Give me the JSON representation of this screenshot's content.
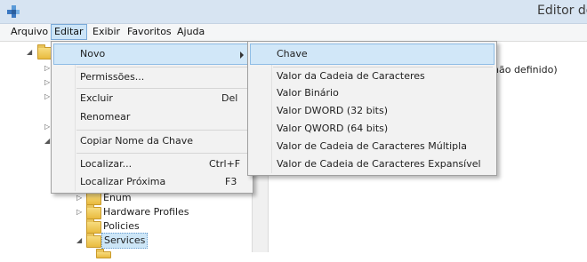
{
  "window": {
    "title": "Editor do Registro"
  },
  "menubar": {
    "items": [
      "Arquivo",
      "Editar",
      "Exibir",
      "Favoritos",
      "Ajuda"
    ]
  },
  "edit_menu": {
    "items": [
      {
        "label": "Novo",
        "shortcut": "",
        "submenu": true
      },
      {
        "label": "Permissões...",
        "shortcut": ""
      },
      {
        "label": "Excluir",
        "shortcut": "Del"
      },
      {
        "label": "Renomear",
        "shortcut": ""
      },
      {
        "label": "Copiar Nome da Chave",
        "shortcut": ""
      },
      {
        "label": "Localizar...",
        "shortcut": "Ctrl+F"
      },
      {
        "label": "Localizar Próxima",
        "shortcut": "F3"
      }
    ]
  },
  "new_submenu": {
    "items": [
      "Chave",
      "Valor da Cadeia de Caracteres",
      "Valor Binário",
      "Valor DWORD (32 bits)",
      "Valor QWORD (64 bits)",
      "Valor de Cadeia de Caracteres Múltipla",
      "Valor de Cadeia de Caracteres Expansível"
    ]
  },
  "right_pane": {
    "value_fragment": "não definido)"
  },
  "tree": {
    "nodes": [
      "Enum",
      "Hardware Profiles",
      "Policies",
      "Services"
    ],
    "selected": "Services"
  },
  "colors": {
    "highlight": "#d1e7f8",
    "menu_bg": "#f2f2f2",
    "titlebar": "#d7e4f2"
  }
}
